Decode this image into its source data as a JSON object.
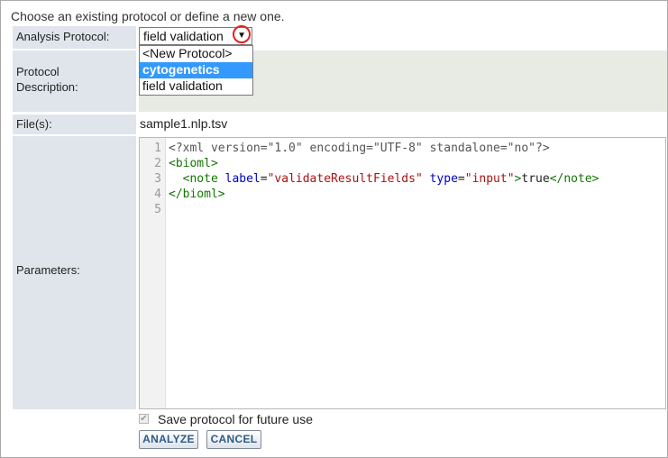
{
  "intro_text": "Choose an existing protocol or define a new one.",
  "labels": {
    "analysis_protocol": "Analysis Protocol:",
    "protocol_description_line1": "Protocol",
    "protocol_description_line2": "Description:",
    "files": "File(s):",
    "parameters": "Parameters:"
  },
  "protocol_select": {
    "selected_value": "field validation",
    "options": [
      "<New Protocol>",
      "cytogenetics",
      "field validation"
    ],
    "highlighted_option": "cytogenetics"
  },
  "files_value": "sample1.nlp.tsv",
  "editor": {
    "line_numbers": [
      "1",
      "2",
      "3",
      "4",
      "5"
    ],
    "lines": [
      [
        {
          "t": "<?xml version=\"1.0\" encoding=\"UTF-8\" standalone=\"no\"?>",
          "c": "meta"
        }
      ],
      [
        {
          "t": "<bioml>",
          "c": "tag"
        }
      ],
      [
        {
          "t": "  ",
          "c": "txt"
        },
        {
          "t": "<note",
          "c": "tag"
        },
        {
          "t": " label",
          "c": "attr"
        },
        {
          "t": "=",
          "c": "txt"
        },
        {
          "t": "\"validateResultFields\"",
          "c": "str"
        },
        {
          "t": " type",
          "c": "attr"
        },
        {
          "t": "=",
          "c": "txt"
        },
        {
          "t": "\"input\"",
          "c": "str"
        },
        {
          "t": ">",
          "c": "tag"
        },
        {
          "t": "true",
          "c": "txt"
        },
        {
          "t": "</note>",
          "c": "tag"
        }
      ],
      [
        {
          "t": "</bioml>",
          "c": "tag"
        }
      ],
      []
    ]
  },
  "save_protocol": {
    "label": "Save protocol for future use",
    "checked": true
  },
  "buttons": {
    "analyze": "ANALYZE",
    "cancel": "CANCEL"
  },
  "colors": {
    "label_bg": "#e0e5eb",
    "highlight": "#3399ff",
    "callout": "#dd2222",
    "button_text": "#2e5a88"
  }
}
